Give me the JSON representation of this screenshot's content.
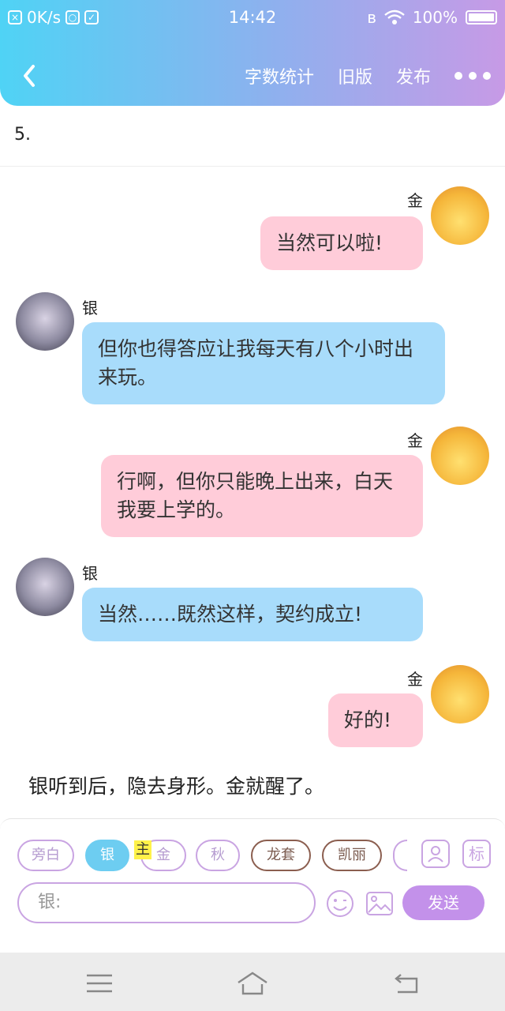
{
  "status_bar": {
    "network_speed": "0K/s",
    "time": "14:42",
    "battery": "100%"
  },
  "nav": {
    "actions": [
      "字数统计",
      "旧版",
      "发布"
    ]
  },
  "chapter_number": "5.",
  "messages": [
    {
      "speaker": "金",
      "text": "当然可以啦!",
      "side": "right"
    },
    {
      "speaker": "银",
      "text": "但你也得答应让我每天有八个小时出来玩。",
      "side": "left"
    },
    {
      "speaker": "金",
      "text": "行啊，但你只能晚上出来，白天我要上学的。",
      "side": "right"
    },
    {
      "speaker": "银",
      "text": "当然……既然这样，契约成立!",
      "side": "left"
    },
    {
      "speaker": "金",
      "text": "好的!",
      "side": "right"
    }
  ],
  "narration": "银听到后，隐去身形。金就醒了。",
  "composer": {
    "characters": [
      "旁白",
      "银",
      "金",
      "秋",
      "龙套",
      "凯丽"
    ],
    "selected": "银",
    "main_badge": "主",
    "tag_button": "标",
    "input_value": "银:",
    "send_label": "发送"
  },
  "colors": {
    "accent": "#c391ea",
    "bubble_right": "#ffccd9",
    "bubble_left": "#a8dcfb",
    "selected_chip": "#6dcdf1"
  }
}
